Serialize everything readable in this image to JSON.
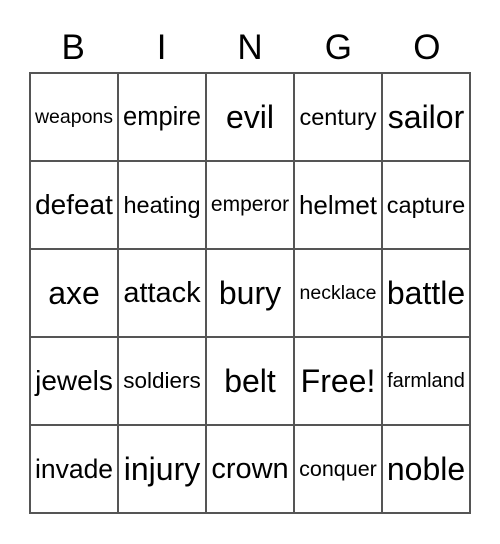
{
  "header": [
    "B",
    "I",
    "N",
    "G",
    "O"
  ],
  "cells": [
    [
      "weapons",
      "empire",
      "evil",
      "century",
      "sailor"
    ],
    [
      "defeat",
      "heating",
      "emperor",
      "helmet",
      "capture"
    ],
    [
      "axe",
      "attack",
      "bury",
      "necklace",
      "battle"
    ],
    [
      "jewels",
      "soldiers",
      "belt",
      "Free!",
      "farmland"
    ],
    [
      "invade",
      "injury",
      "crown",
      "conquer",
      "noble"
    ]
  ]
}
